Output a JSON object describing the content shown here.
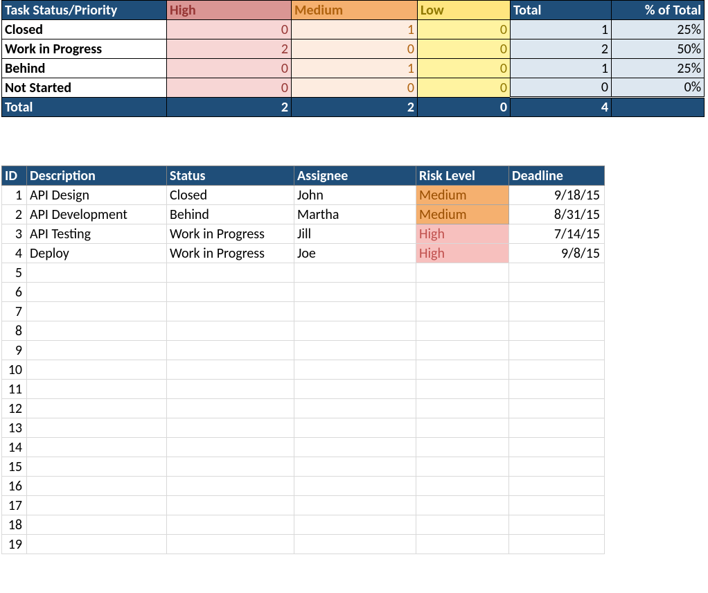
{
  "summary": {
    "headers": {
      "status": "Task Status/Priority",
      "high": "High",
      "medium": "Medium",
      "low": "Low",
      "total": "Total",
      "pct": "% of Total"
    },
    "rows": [
      {
        "label": "Closed",
        "high": "0",
        "medium": "1",
        "low": "0",
        "total": "1",
        "pct": "25%"
      },
      {
        "label": "Work in Progress",
        "high": "2",
        "medium": "0",
        "low": "0",
        "total": "2",
        "pct": "50%"
      },
      {
        "label": "Behind",
        "high": "0",
        "medium": "1",
        "low": "0",
        "total": "1",
        "pct": "25%"
      },
      {
        "label": "Not Started",
        "high": "0",
        "medium": "0",
        "low": "0",
        "total": "0",
        "pct": "0%"
      }
    ],
    "totals": {
      "label": "Total",
      "high": "2",
      "medium": "2",
      "low": "0",
      "total": "4",
      "pct": ""
    }
  },
  "tasks": {
    "headers": {
      "id": "ID",
      "desc": "Description",
      "status": "Status",
      "assignee": "Assignee",
      "risk": "Risk Level",
      "deadline": "Deadline"
    },
    "rows": [
      {
        "id": "1",
        "desc": "API Design",
        "status": "Closed",
        "assignee": "John",
        "risk": "Medium",
        "deadline": "9/18/15"
      },
      {
        "id": "2",
        "desc": "API Development",
        "status": "Behind",
        "assignee": "Martha",
        "risk": "Medium",
        "deadline": "8/31/15"
      },
      {
        "id": "3",
        "desc": "API Testing",
        "status": "Work in Progress",
        "assignee": "Jill",
        "risk": "High",
        "deadline": "7/14/15"
      },
      {
        "id": "4",
        "desc": "Deploy",
        "status": "Work in Progress",
        "assignee": "Joe",
        "risk": "High",
        "deadline": "9/8/15"
      },
      {
        "id": "5",
        "desc": "",
        "status": "",
        "assignee": "",
        "risk": "",
        "deadline": ""
      },
      {
        "id": "6",
        "desc": "",
        "status": "",
        "assignee": "",
        "risk": "",
        "deadline": ""
      },
      {
        "id": "7",
        "desc": "",
        "status": "",
        "assignee": "",
        "risk": "",
        "deadline": ""
      },
      {
        "id": "8",
        "desc": "",
        "status": "",
        "assignee": "",
        "risk": "",
        "deadline": ""
      },
      {
        "id": "9",
        "desc": "",
        "status": "",
        "assignee": "",
        "risk": "",
        "deadline": ""
      },
      {
        "id": "10",
        "desc": "",
        "status": "",
        "assignee": "",
        "risk": "",
        "deadline": ""
      },
      {
        "id": "11",
        "desc": "",
        "status": "",
        "assignee": "",
        "risk": "",
        "deadline": ""
      },
      {
        "id": "12",
        "desc": "",
        "status": "",
        "assignee": "",
        "risk": "",
        "deadline": ""
      },
      {
        "id": "13",
        "desc": "",
        "status": "",
        "assignee": "",
        "risk": "",
        "deadline": ""
      },
      {
        "id": "14",
        "desc": "",
        "status": "",
        "assignee": "",
        "risk": "",
        "deadline": ""
      },
      {
        "id": "15",
        "desc": "",
        "status": "",
        "assignee": "",
        "risk": "",
        "deadline": ""
      },
      {
        "id": "16",
        "desc": "",
        "status": "",
        "assignee": "",
        "risk": "",
        "deadline": ""
      },
      {
        "id": "17",
        "desc": "",
        "status": "",
        "assignee": "",
        "risk": "",
        "deadline": ""
      },
      {
        "id": "18",
        "desc": "",
        "status": "",
        "assignee": "",
        "risk": "",
        "deadline": ""
      },
      {
        "id": "19",
        "desc": "",
        "status": "",
        "assignee": "",
        "risk": "",
        "deadline": ""
      }
    ]
  }
}
